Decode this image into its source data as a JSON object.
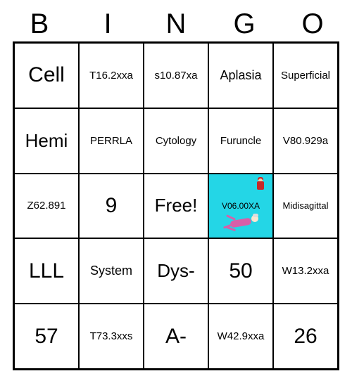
{
  "header": [
    "B",
    "I",
    "N",
    "G",
    "O"
  ],
  "grid": [
    [
      {
        "text": "Cell",
        "size": "xl"
      },
      {
        "text": "T16.2xxa",
        "size": "sm"
      },
      {
        "text": "s10.87xa",
        "size": "sm"
      },
      {
        "text": "Aplasia",
        "size": "md"
      },
      {
        "text": "Superficial",
        "size": "sm"
      }
    ],
    [
      {
        "text": "Hemi",
        "size": "lg"
      },
      {
        "text": "PERRLA",
        "size": "sm"
      },
      {
        "text": "Cytology",
        "size": "sm"
      },
      {
        "text": "Furuncle",
        "size": "sm"
      },
      {
        "text": "V80.929a",
        "size": "sm"
      }
    ],
    [
      {
        "text": "Z62.891",
        "size": "sm"
      },
      {
        "text": "9",
        "size": "xl"
      },
      {
        "text": "Free!",
        "size": "lg"
      },
      {
        "text": "V06.00XA",
        "size": "xs",
        "special": "image"
      },
      {
        "text": "Midisagittal",
        "size": "xs"
      }
    ],
    [
      {
        "text": "LLL",
        "size": "xl"
      },
      {
        "text": "System",
        "size": "md"
      },
      {
        "text": "Dys-",
        "size": "lg"
      },
      {
        "text": "50",
        "size": "xl"
      },
      {
        "text": "W13.2xxa",
        "size": "sm"
      }
    ],
    [
      {
        "text": "57",
        "size": "xl"
      },
      {
        "text": "T73.3xxs",
        "size": "sm"
      },
      {
        "text": "A-",
        "size": "xl"
      },
      {
        "text": "W42.9xxa",
        "size": "sm"
      },
      {
        "text": "26",
        "size": "xl"
      }
    ]
  ]
}
